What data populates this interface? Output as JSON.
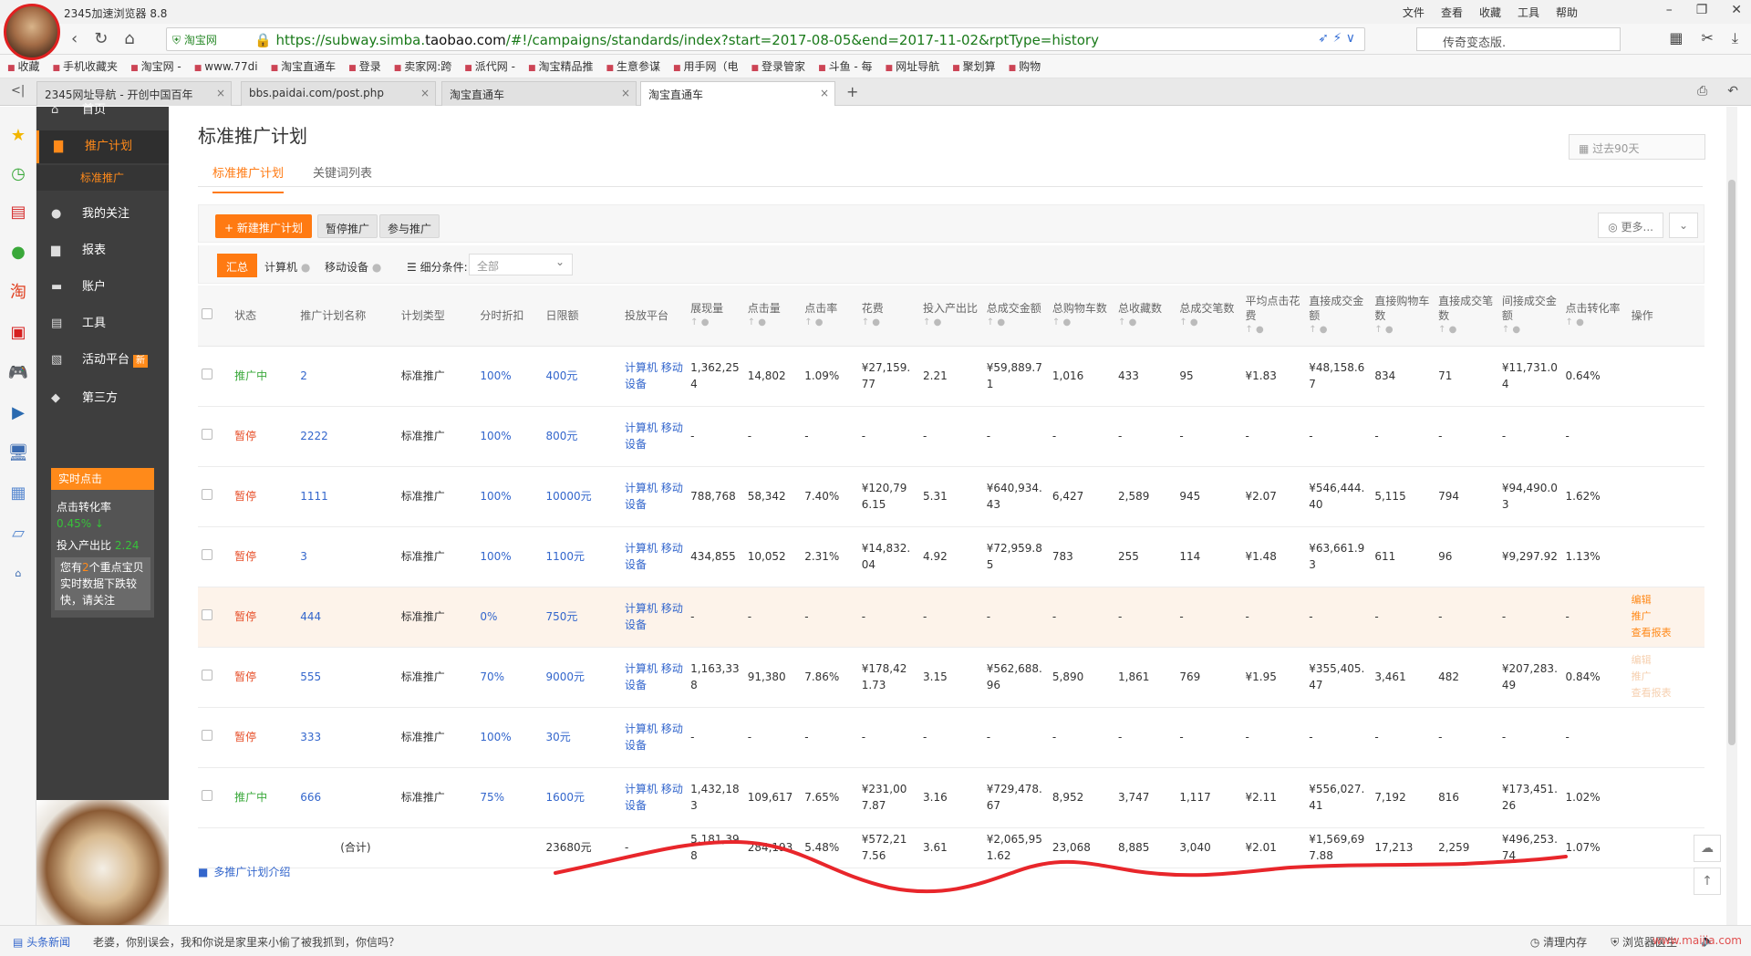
{
  "browser": {
    "title": "2345加速浏览器 8.8",
    "menus": [
      "文件",
      "查看",
      "收藏",
      "工具",
      "帮助"
    ],
    "site_badge": "淘宝网",
    "url_prefix": "https://subway.simba.",
    "url_domain": "taobao.com",
    "url_suffix": "/#!/campaigns/standards/index?start=2017-08-05&end=2017-11-02&rptType=history",
    "search_text": "传奇变态版.",
    "favorites": [
      "收藏",
      "手机收藏夹",
      "淘宝网 -",
      "www.77di",
      "淘宝直通车",
      "登录",
      "卖家网:跨",
      "派代网 -",
      "淘宝精品推",
      "生意参谋",
      "用手网（电",
      "登录管家",
      "斗鱼 - 每",
      "网址导航",
      "聚划算",
      "购物"
    ],
    "tabs": [
      {
        "label": "2345网址导航 - 开创中国百年"
      },
      {
        "label": "bbs.paidai.com/post.php"
      },
      {
        "label": "淘宝直通车"
      },
      {
        "label": "淘宝直通车"
      }
    ]
  },
  "sidebar": {
    "home": "首页",
    "items": [
      {
        "label": "推广计划",
        "icon": "folder-icon"
      },
      {
        "label": "我的关注",
        "icon": "star-icon"
      },
      {
        "label": "报表",
        "icon": "report-icon"
      },
      {
        "label": "账户",
        "icon": "account-icon"
      },
      {
        "label": "工具",
        "icon": "tools-icon"
      },
      {
        "label": "活动平台",
        "icon": "gift-icon",
        "badge": "新"
      },
      {
        "label": "第三方",
        "icon": "thirdparty-icon"
      }
    ],
    "sub_label": "标准推广",
    "realtime": {
      "title": "实时点击",
      "ctr_label": "点击转化率",
      "ctr_value": "0.45% ↓",
      "roi_label": "投入产出比",
      "roi_value": "2.24",
      "warn_pre": "您有",
      "warn_count": "2",
      "warn_post": "个重点宝贝实时数据下跌较快，请关注"
    }
  },
  "main": {
    "title": "标准推广计划",
    "date_range": "过去90天",
    "tabs": [
      "标准推广计划",
      "关键词列表"
    ],
    "buttons": {
      "new_plan": "+ 新建推广计划",
      "pause": "暂停推广",
      "join": "参与推广",
      "more": "◎ 更多..."
    },
    "segments": [
      "汇总",
      "计算机",
      "移动设备"
    ],
    "filter_label": "细分条件:",
    "filter_value": "全部",
    "columns": [
      "状态",
      "推广计划名称",
      "计划类型",
      "分时折扣",
      "日限额",
      "投放平台",
      "展现量",
      "点击量",
      "点击率",
      "花费",
      "投入产出比",
      "总成交金额",
      "总购物车数",
      "总收藏数",
      "总成交笔数",
      "平均点击花费",
      "直接成交金额",
      "直接购物车数",
      "直接成交笔数",
      "间接成交金额",
      "点击转化率",
      "操作"
    ],
    "rows": [
      {
        "status": "推广中",
        "on": true,
        "name": "2",
        "type": "标准推广",
        "discount": "100%",
        "limit": "400元",
        "platform": "计算机 移动设备",
        "impr": "1,362,254",
        "clicks": "14,802",
        "ctr": "1.09%",
        "cost": "¥27,159.77",
        "roi": "2.21",
        "gmv": "¥59,889.71",
        "cart": "1,016",
        "fav": "433",
        "orders": "95",
        "cpc": "¥1.83",
        "dgmv": "¥48,158.67",
        "dcart": "834",
        "dorders": "71",
        "igmv": "¥11,731.04",
        "cvr": "0.64%"
      },
      {
        "status": "暂停",
        "on": false,
        "name": "2222",
        "type": "标准推广",
        "discount": "100%",
        "limit": "800元",
        "platform": "计算机 移动设备",
        "impr": "-",
        "clicks": "-",
        "ctr": "-",
        "cost": "-",
        "roi": "-",
        "gmv": "-",
        "cart": "-",
        "fav": "-",
        "orders": "-",
        "cpc": "-",
        "dgmv": "-",
        "dcart": "-",
        "dorders": "-",
        "igmv": "-",
        "cvr": "-"
      },
      {
        "status": "暂停",
        "on": false,
        "name": "1111",
        "type": "标准推广",
        "discount": "100%",
        "limit": "10000元",
        "platform": "计算机 移动设备",
        "impr": "788,768",
        "clicks": "58,342",
        "ctr": "7.40%",
        "cost": "¥120,796.15",
        "roi": "5.31",
        "gmv": "¥640,934.43",
        "cart": "6,427",
        "fav": "2,589",
        "orders": "945",
        "cpc": "¥2.07",
        "dgmv": "¥546,444.40",
        "dcart": "5,115",
        "dorders": "794",
        "igmv": "¥94,490.03",
        "cvr": "1.62%"
      },
      {
        "status": "暂停",
        "on": false,
        "name": "3",
        "type": "标准推广",
        "discount": "100%",
        "limit": "1100元",
        "platform": "计算机 移动设备",
        "impr": "434,855",
        "clicks": "10,052",
        "ctr": "2.31%",
        "cost": "¥14,832.04",
        "roi": "4.92",
        "gmv": "¥72,959.85",
        "cart": "783",
        "fav": "255",
        "orders": "114",
        "cpc": "¥1.48",
        "dgmv": "¥63,661.93",
        "dcart": "611",
        "dorders": "96",
        "igmv": "¥9,297.92",
        "cvr": "1.13%"
      },
      {
        "status": "暂停",
        "on": false,
        "name": "444",
        "type": "标准推广",
        "discount": "0%",
        "limit": "750元",
        "platform": "计算机 移动设备",
        "impr": "-",
        "clicks": "-",
        "ctr": "-",
        "cost": "-",
        "roi": "-",
        "gmv": "-",
        "cart": "-",
        "fav": "-",
        "orders": "-",
        "cpc": "-",
        "dgmv": "-",
        "dcart": "-",
        "dorders": "-",
        "igmv": "-",
        "cvr": "-",
        "ops": [
          "编辑",
          "推广",
          "查看报表"
        ]
      },
      {
        "status": "暂停",
        "on": false,
        "name": "555",
        "type": "标准推广",
        "discount": "70%",
        "limit": "9000元",
        "platform": "计算机 移动设备",
        "impr": "1,163,338",
        "clicks": "91,380",
        "ctr": "7.86%",
        "cost": "¥178,421.73",
        "roi": "3.15",
        "gmv": "¥562,688.96",
        "cart": "5,890",
        "fav": "1,861",
        "orders": "769",
        "cpc": "¥1.95",
        "dgmv": "¥355,405.47",
        "dcart": "3,461",
        "dorders": "482",
        "igmv": "¥207,283.49",
        "cvr": "0.84%",
        "ops_faint": [
          "编辑",
          "推广",
          "查看报表"
        ]
      },
      {
        "status": "暂停",
        "on": false,
        "name": "333",
        "type": "标准推广",
        "discount": "100%",
        "limit": "30元",
        "platform": "计算机 移动设备",
        "impr": "-",
        "clicks": "-",
        "ctr": "-",
        "cost": "-",
        "roi": "-",
        "gmv": "-",
        "cart": "-",
        "fav": "-",
        "orders": "-",
        "cpc": "-",
        "dgmv": "-",
        "dcart": "-",
        "dorders": "-",
        "igmv": "-",
        "cvr": "-"
      },
      {
        "status": "推广中",
        "on": true,
        "name": "666",
        "type": "标准推广",
        "discount": "75%",
        "limit": "1600元",
        "platform": "计算机 移动设备",
        "impr": "1,432,183",
        "clicks": "109,617",
        "ctr": "7.65%",
        "cost": "¥231,007.87",
        "roi": "3.16",
        "gmv": "¥729,478.67",
        "cart": "8,952",
        "fav": "3,747",
        "orders": "1,117",
        "cpc": "¥2.11",
        "dgmv": "¥556,027.41",
        "dcart": "7,192",
        "dorders": "816",
        "igmv": "¥173,451.26",
        "cvr": "1.02%"
      }
    ],
    "total": {
      "label": "(合计)",
      "limit": "23680元",
      "platform": "-",
      "impr": "5,181,398",
      "clicks": "284,193",
      "ctr": "5.48%",
      "cost": "¥572,217.56",
      "roi": "3.61",
      "gmv": "¥2,065,951.62",
      "cart": "23,068",
      "fav": "8,885",
      "orders": "3,040",
      "cpc": "¥2.01",
      "dgmv": "¥1,569,697.88",
      "dcart": "17,213",
      "dorders": "2,259",
      "igmv": "¥496,253.74",
      "cvr": "1.07%"
    },
    "intro_link": "多推广计划介绍"
  },
  "statusbar": {
    "news": "头条新闻",
    "message": "老婆，你别误会，我和你说是家里来小偷了被我抓到，你信吗？",
    "tools": [
      "清理内存",
      "浏览器医生"
    ],
    "watermark": "www.maijia.com"
  },
  "colors": {
    "accent": "#ff7a12",
    "link": "#3366cc",
    "on": "#39a83a",
    "off": "#e7502b",
    "annotation": "#e8262b"
  }
}
